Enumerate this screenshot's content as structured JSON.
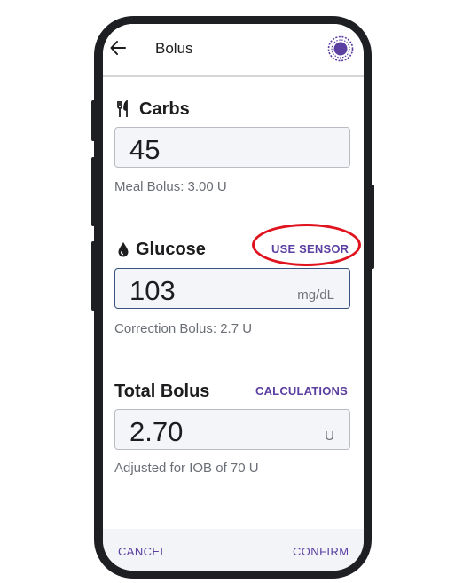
{
  "header": {
    "title": "Bolus",
    "back_icon": "arrow-left-icon",
    "sensor_icon": "sensor-icon",
    "accent": "#5b3fa1"
  },
  "carbs": {
    "icon": "fork-knife-icon",
    "title": "Carbs",
    "value": "45",
    "helper": "Meal Bolus: 3.00 U"
  },
  "glucose": {
    "icon": "drop-icon",
    "title": "Glucose",
    "action": "USE SENSOR",
    "value": "103",
    "unit": "mg/dL",
    "helper": "Correction Bolus: 2.7 U"
  },
  "total": {
    "title": "Total Bolus",
    "action": "CALCULATIONS",
    "value": "2.70",
    "unit": "U",
    "helper": "Adjusted for IOB of 70 U"
  },
  "footer": {
    "cancel": "CANCEL",
    "confirm": "CONFIRM"
  },
  "annotation_color": "#e0141e"
}
